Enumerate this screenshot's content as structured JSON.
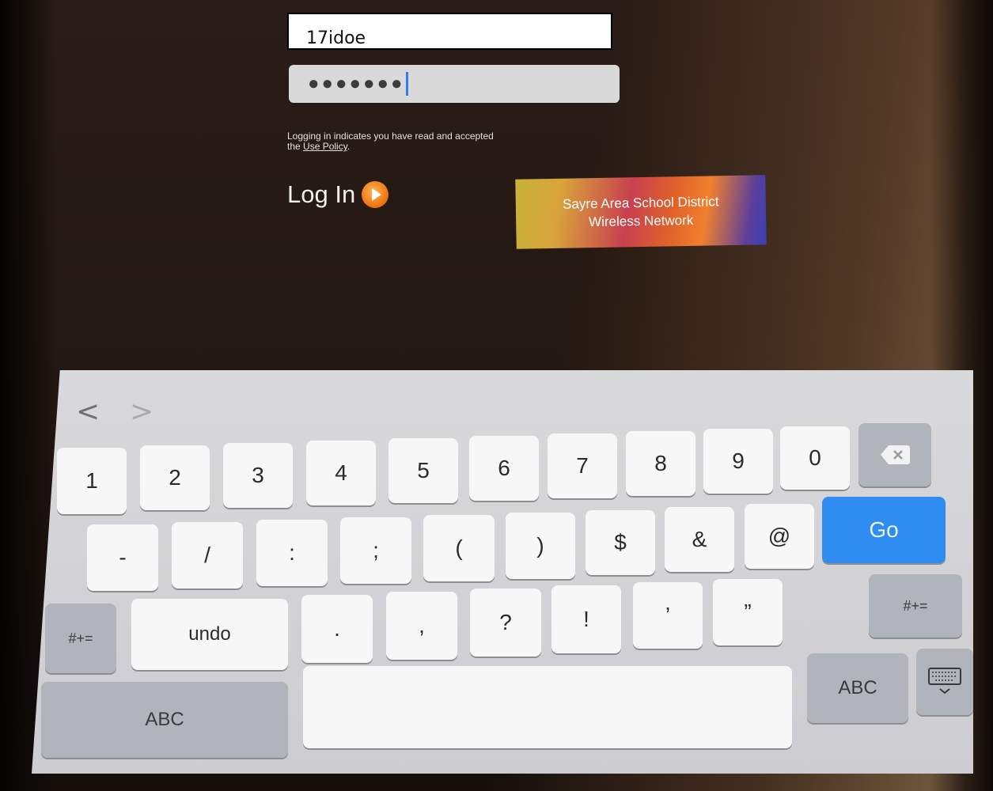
{
  "login_form": {
    "username_value": "17idoe",
    "password_masked": "●●●●●●●",
    "policy_text": "Logging in indicates you have read and accepted the",
    "policy_link": "Use Policy",
    "policy_end": ".",
    "login_label": "Log In"
  },
  "banner": {
    "line1": "Sayre Area School District",
    "line2": "Wireless Network"
  },
  "keyboard": {
    "nav_back": "<",
    "nav_forward": ">",
    "row1": [
      "1",
      "2",
      "3",
      "4",
      "5",
      "6",
      "7",
      "8",
      "9",
      "0"
    ],
    "row2": [
      "-",
      "/",
      ":",
      ";",
      "(",
      ")",
      "$",
      "&",
      "@"
    ],
    "go_label": "Go",
    "row3": [
      ".",
      ",",
      "?",
      "!",
      "’",
      "”"
    ],
    "shift_label": "#+=",
    "undo_label": "undo",
    "abc_label": "ABC"
  },
  "colors": {
    "accent": "#2f8cf0",
    "login_icon": "#f07a15"
  }
}
